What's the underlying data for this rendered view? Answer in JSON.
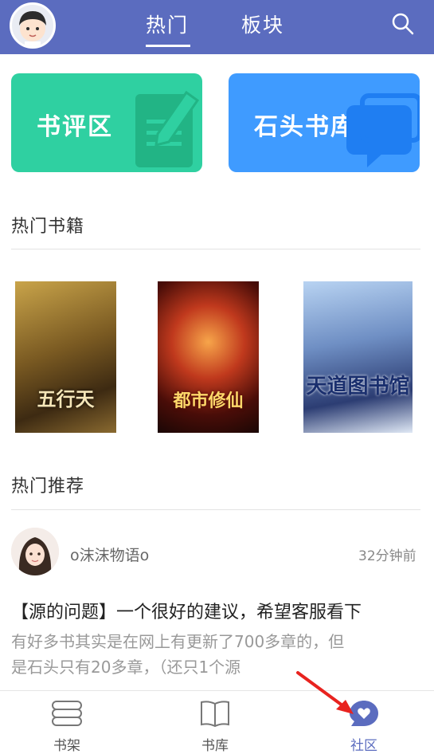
{
  "header": {
    "tabs": [
      {
        "label": "热门",
        "active": true
      },
      {
        "label": "板块",
        "active": false
      }
    ],
    "search_icon": "search-icon",
    "avatar_icon": "user-avatar"
  },
  "categories": [
    {
      "label": "书评区",
      "color": "#2fd0a1",
      "icon": "document-pencil-icon"
    },
    {
      "label": "石头书库",
      "color": "#3f9bff",
      "icon": "chat-bubble-icon"
    }
  ],
  "hot_books": {
    "title": "热门书籍",
    "books": [
      {
        "cover_text": "五行天"
      },
      {
        "cover_text": "都市修仙"
      },
      {
        "cover_text": "天道图书馆"
      }
    ]
  },
  "hot_recommend": {
    "title": "热门推荐",
    "post": {
      "username": "o沫沫物语o",
      "time": "32分钟前",
      "title": "【源的问题】一个很好的建议，希望客服看下",
      "body": "有好多书其实是在网上有更新了700多章的，但是石头只有20多章，（还只1个源"
    }
  },
  "bottom_nav": [
    {
      "label": "书架",
      "icon": "bookshelf-icon",
      "active": false
    },
    {
      "label": "书库",
      "icon": "open-book-icon",
      "active": false
    },
    {
      "label": "社区",
      "icon": "heart-chat-icon",
      "active": true
    }
  ],
  "colors": {
    "brand": "#5b6cbf",
    "annotation": "#e8231f"
  }
}
